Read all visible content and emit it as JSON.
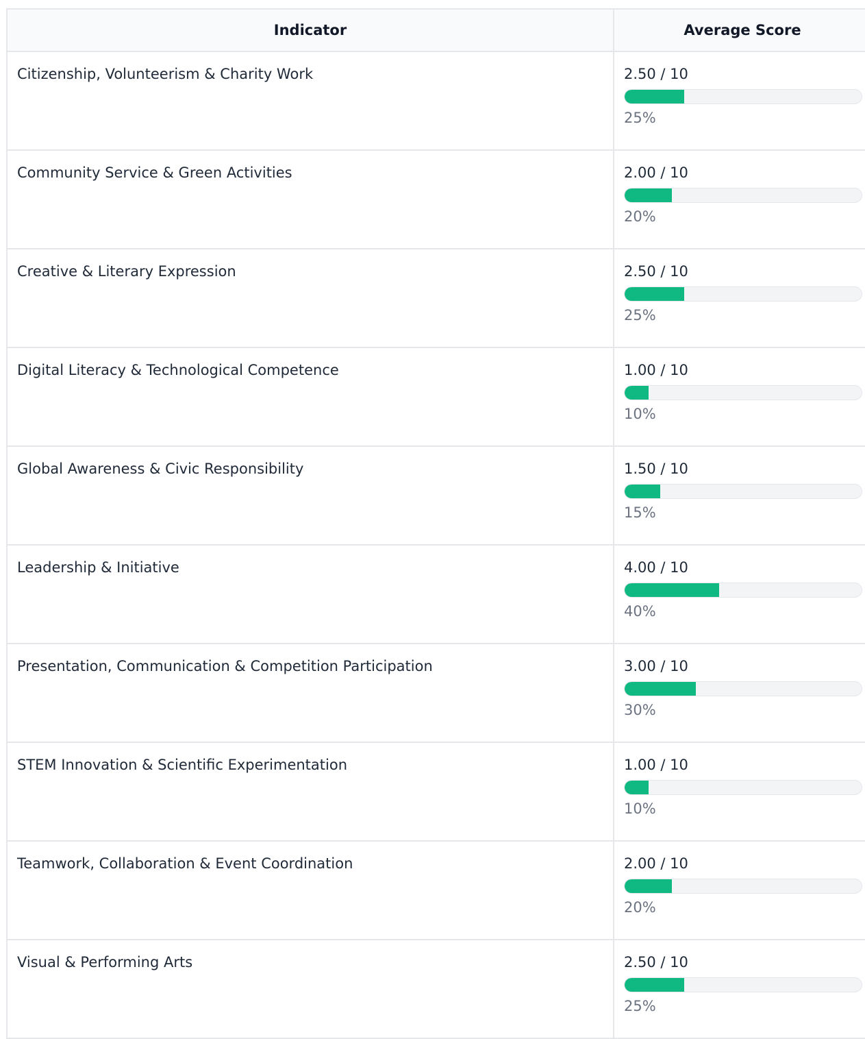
{
  "table": {
    "headers": {
      "indicator": "Indicator",
      "average_score": "Average Score"
    },
    "rows": [
      {
        "indicator": "Citizenship, Volunteerism & Charity Work",
        "score": "2.50 / 10",
        "percent_label": "25%",
        "fraction": 0.25
      },
      {
        "indicator": "Community Service & Green Activities",
        "score": "2.00 / 10",
        "percent_label": "20%",
        "fraction": 0.2
      },
      {
        "indicator": "Creative & Literary Expression",
        "score": "2.50 / 10",
        "percent_label": "25%",
        "fraction": 0.25
      },
      {
        "indicator": "Digital Literacy & Technological Competence",
        "score": "1.00 / 10",
        "percent_label": "10%",
        "fraction": 0.1
      },
      {
        "indicator": "Global Awareness & Civic Responsibility",
        "score": "1.50 / 10",
        "percent_label": "15%",
        "fraction": 0.15
      },
      {
        "indicator": "Leadership & Initiative",
        "score": "4.00 / 10",
        "percent_label": "40%",
        "fraction": 0.4
      },
      {
        "indicator": "Presentation, Communication & Competition Participation",
        "score": "3.00 / 10",
        "percent_label": "30%",
        "fraction": 0.3
      },
      {
        "indicator": "STEM Innovation & Scientific Experimentation",
        "score": "1.00 / 10",
        "percent_label": "10%",
        "fraction": 0.1
      },
      {
        "indicator": "Teamwork, Collaboration & Event Coordination",
        "score": "2.00 / 10",
        "percent_label": "20%",
        "fraction": 0.2
      },
      {
        "indicator": "Visual & Performing Arts",
        "score": "2.50 / 10",
        "percent_label": "25%",
        "fraction": 0.25
      }
    ]
  },
  "colors": {
    "bar_fill": "#10b981",
    "bar_track": "#f3f4f6",
    "header_bg": "#f9fafb",
    "border": "#e5e7eb",
    "percent_text": "#6b7280"
  }
}
